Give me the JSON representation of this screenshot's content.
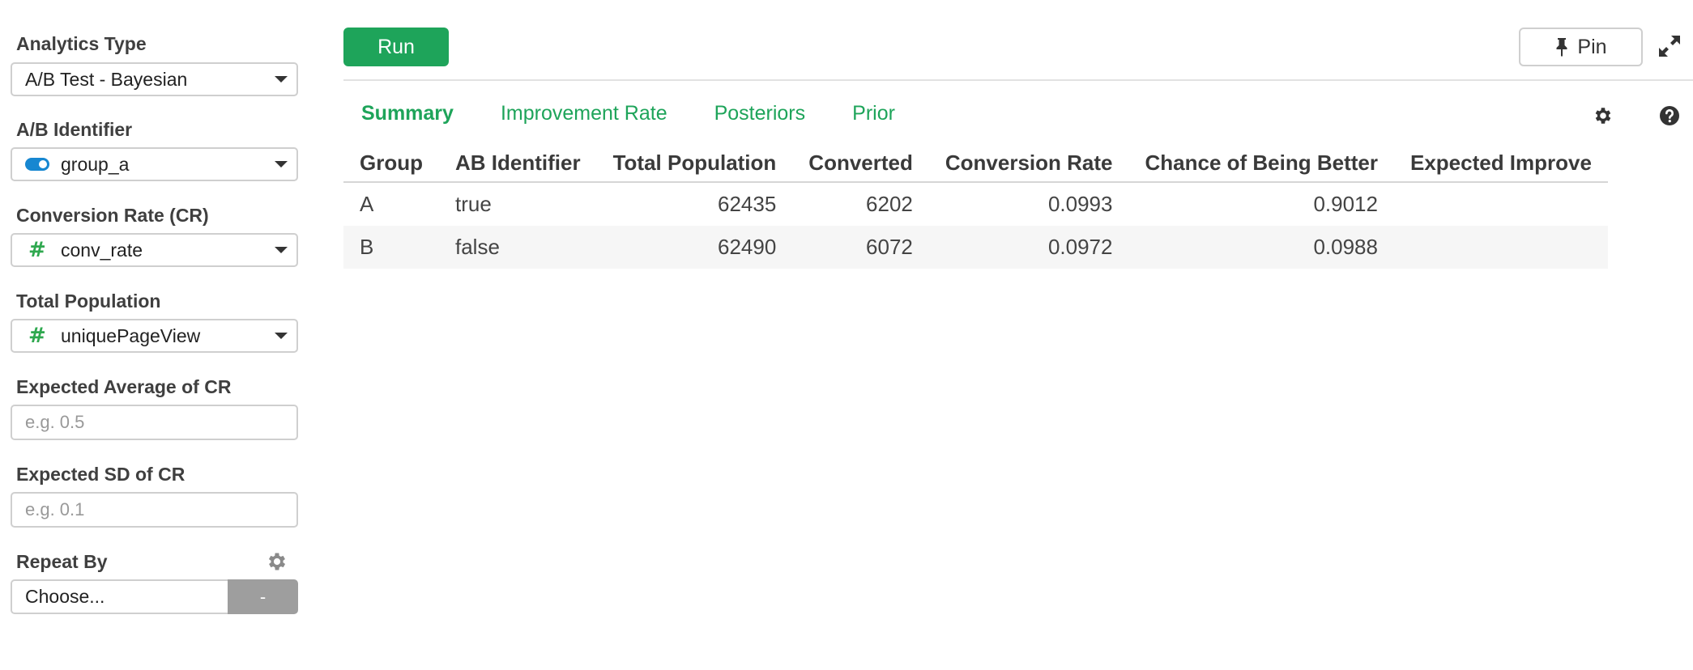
{
  "sidebar": {
    "analytics_type": {
      "label": "Analytics Type",
      "value": "A/B Test - Bayesian"
    },
    "ab_identifier": {
      "label": "A/B Identifier",
      "value": "group_a",
      "type_icon": "toggle-icon"
    },
    "conversion_rate": {
      "label": "Conversion Rate (CR)",
      "value": "conv_rate",
      "type_icon": "#"
    },
    "total_population": {
      "label": "Total Population",
      "value": "uniquePageView",
      "type_icon": "#"
    },
    "expected_avg": {
      "label": "Expected Average of CR",
      "placeholder": "e.g. 0.5"
    },
    "expected_sd": {
      "label": "Expected SD of CR",
      "placeholder": "e.g. 0.1"
    },
    "repeat_by": {
      "label": "Repeat By",
      "value": "Choose...",
      "button": "-"
    }
  },
  "toolbar": {
    "run_label": "Run",
    "pin_label": "Pin"
  },
  "tabs": [
    {
      "label": "Summary",
      "active": true
    },
    {
      "label": "Improvement Rate",
      "active": false
    },
    {
      "label": "Posteriors",
      "active": false
    },
    {
      "label": "Prior",
      "active": false
    }
  ],
  "table": {
    "columns": [
      "Group",
      "AB Identifier",
      "Total Population",
      "Converted",
      "Conversion Rate",
      "Chance of Being Better",
      "Expected Improve"
    ],
    "rows": [
      [
        "A",
        "true",
        "62435",
        "6202",
        "0.0993",
        "0.9012",
        ""
      ],
      [
        "B",
        "false",
        "62490",
        "6072",
        "0.0972",
        "0.0988",
        ""
      ]
    ]
  },
  "colors": {
    "accent": "#1ea45a",
    "toggle": "#1787d1",
    "button_gray": "#9e9e9e"
  }
}
